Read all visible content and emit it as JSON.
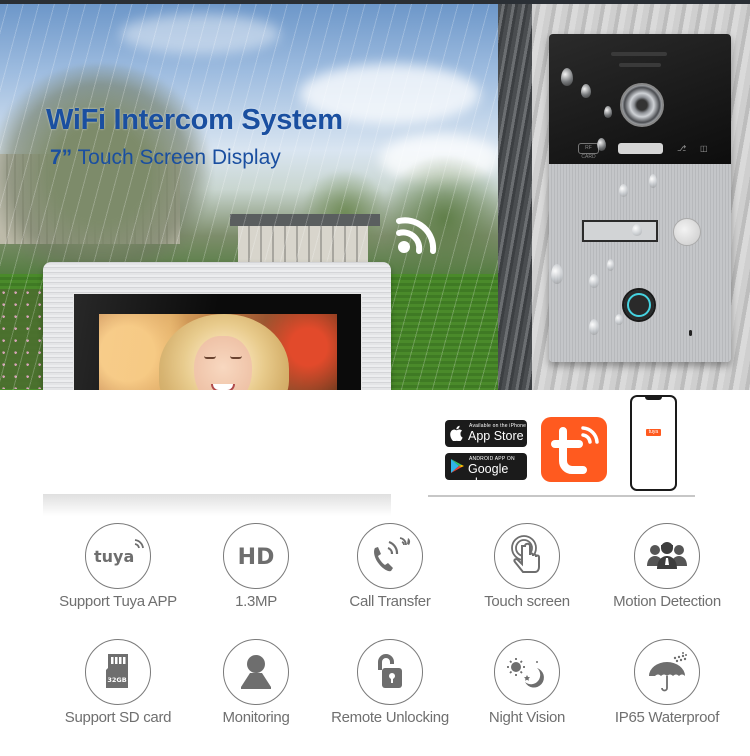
{
  "hero": {
    "title": "WiFi Intercom System",
    "subtitle_size": "7”",
    "subtitle_text": " Touch Screen Display",
    "wifi_icon": "wifi-icon",
    "title_color": "#1a4fa0"
  },
  "doorbell": {
    "rfid_label": "RF CARD",
    "ring_color": "#45d2e0"
  },
  "apps": {
    "apple_small": "Available on the iPhone",
    "apple_big": "App Store",
    "google_small": "ANDROID APP ON",
    "google_big": "Google play",
    "tuya_app_color": "#ff5a1f",
    "phone_logo": "tuya"
  },
  "features": [
    {
      "icon": "tuya-logo-icon",
      "label": "Support Tuya APP",
      "icon_text": "tuya"
    },
    {
      "icon": "hd-icon",
      "label": "1.3MP",
      "icon_text": "HD"
    },
    {
      "icon": "call-transfer-icon",
      "label": "Call Transfer"
    },
    {
      "icon": "touch-hand-icon",
      "label": "Touch screen"
    },
    {
      "icon": "people-group-icon",
      "label": "Motion Detection"
    },
    {
      "icon": "sd-card-icon",
      "label": "Support  SD card",
      "icon_text": "32GB"
    },
    {
      "icon": "person-monitor-icon",
      "label": "Monitoring"
    },
    {
      "icon": "unlocked-padlock-icon",
      "label": "Remote Unlocking"
    },
    {
      "icon": "sun-moon-icon",
      "label": "Night Vision"
    },
    {
      "icon": "umbrella-rain-icon",
      "label": "IP65 Waterproof"
    }
  ],
  "icon_color": "#7a7a7a",
  "label_color": "#6f6f6f"
}
